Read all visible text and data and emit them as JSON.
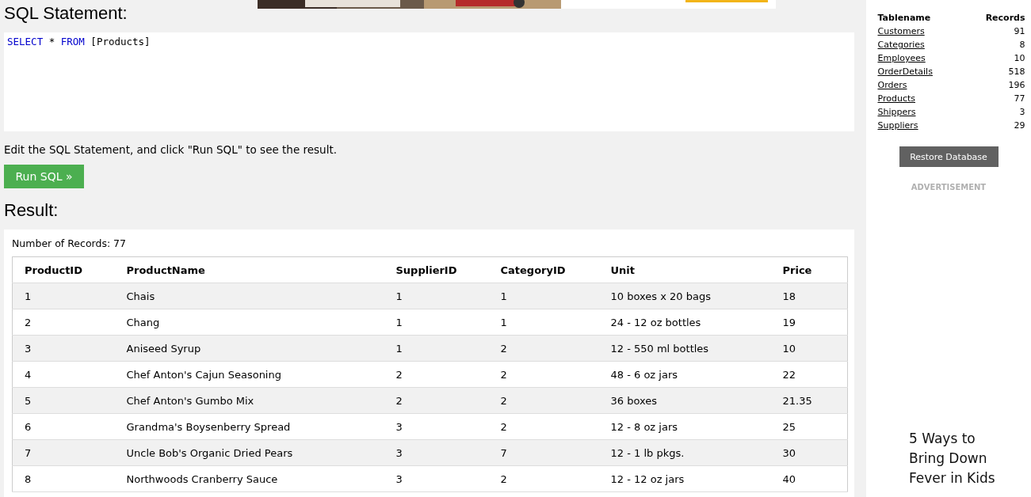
{
  "sql_heading": "SQL Statement:",
  "sql_code": [
    {
      "kind": "keyword",
      "text": "SELECT"
    },
    {
      "kind": "plain",
      "text": " * "
    },
    {
      "kind": "keyword",
      "text": "FROM"
    },
    {
      "kind": "plain",
      "text": " [Products]"
    }
  ],
  "instruction": "Edit the SQL Statement, and click \"Run SQL\" to see the result.",
  "run_button": "Run SQL »",
  "result_heading": "Result:",
  "record_count": "Number of Records: 77",
  "table": {
    "columns": [
      "ProductID",
      "ProductName",
      "SupplierID",
      "CategoryID",
      "Unit",
      "Price"
    ],
    "rows": [
      [
        "1",
        "Chais",
        "1",
        "1",
        "10 boxes x 20 bags",
        "18"
      ],
      [
        "2",
        "Chang",
        "1",
        "1",
        "24 - 12 oz bottles",
        "19"
      ],
      [
        "3",
        "Aniseed Syrup",
        "1",
        "2",
        "12 - 550 ml bottles",
        "10"
      ],
      [
        "4",
        "Chef Anton's Cajun Seasoning",
        "2",
        "2",
        "48 - 6 oz jars",
        "22"
      ],
      [
        "5",
        "Chef Anton's Gumbo Mix",
        "2",
        "2",
        "36 boxes",
        "21.35"
      ],
      [
        "6",
        "Grandma's Boysenberry Spread",
        "3",
        "2",
        "12 - 8 oz jars",
        "25"
      ],
      [
        "7",
        "Uncle Bob's Organic Dried Pears",
        "3",
        "7",
        "12 - 1 lb pkgs.",
        "30"
      ],
      [
        "8",
        "Northwoods Cranberry Sauce",
        "3",
        "2",
        "12 - 12 oz jars",
        "40"
      ]
    ]
  },
  "sidebar": {
    "columns": [
      "Tablename",
      "Records"
    ],
    "tables": [
      {
        "name": "Customers",
        "records": "91"
      },
      {
        "name": "Categories",
        "records": "8"
      },
      {
        "name": "Employees",
        "records": "10"
      },
      {
        "name": "OrderDetails",
        "records": "518"
      },
      {
        "name": "Orders",
        "records": "196"
      },
      {
        "name": "Products",
        "records": "77"
      },
      {
        "name": "Shippers",
        "records": "3"
      },
      {
        "name": "Suppliers",
        "records": "29"
      }
    ],
    "restore_button": "Restore Database",
    "ad_label": "ADVERTISEMENT",
    "ad_headline": "5 Ways to Bring Down Fever in Kids"
  }
}
